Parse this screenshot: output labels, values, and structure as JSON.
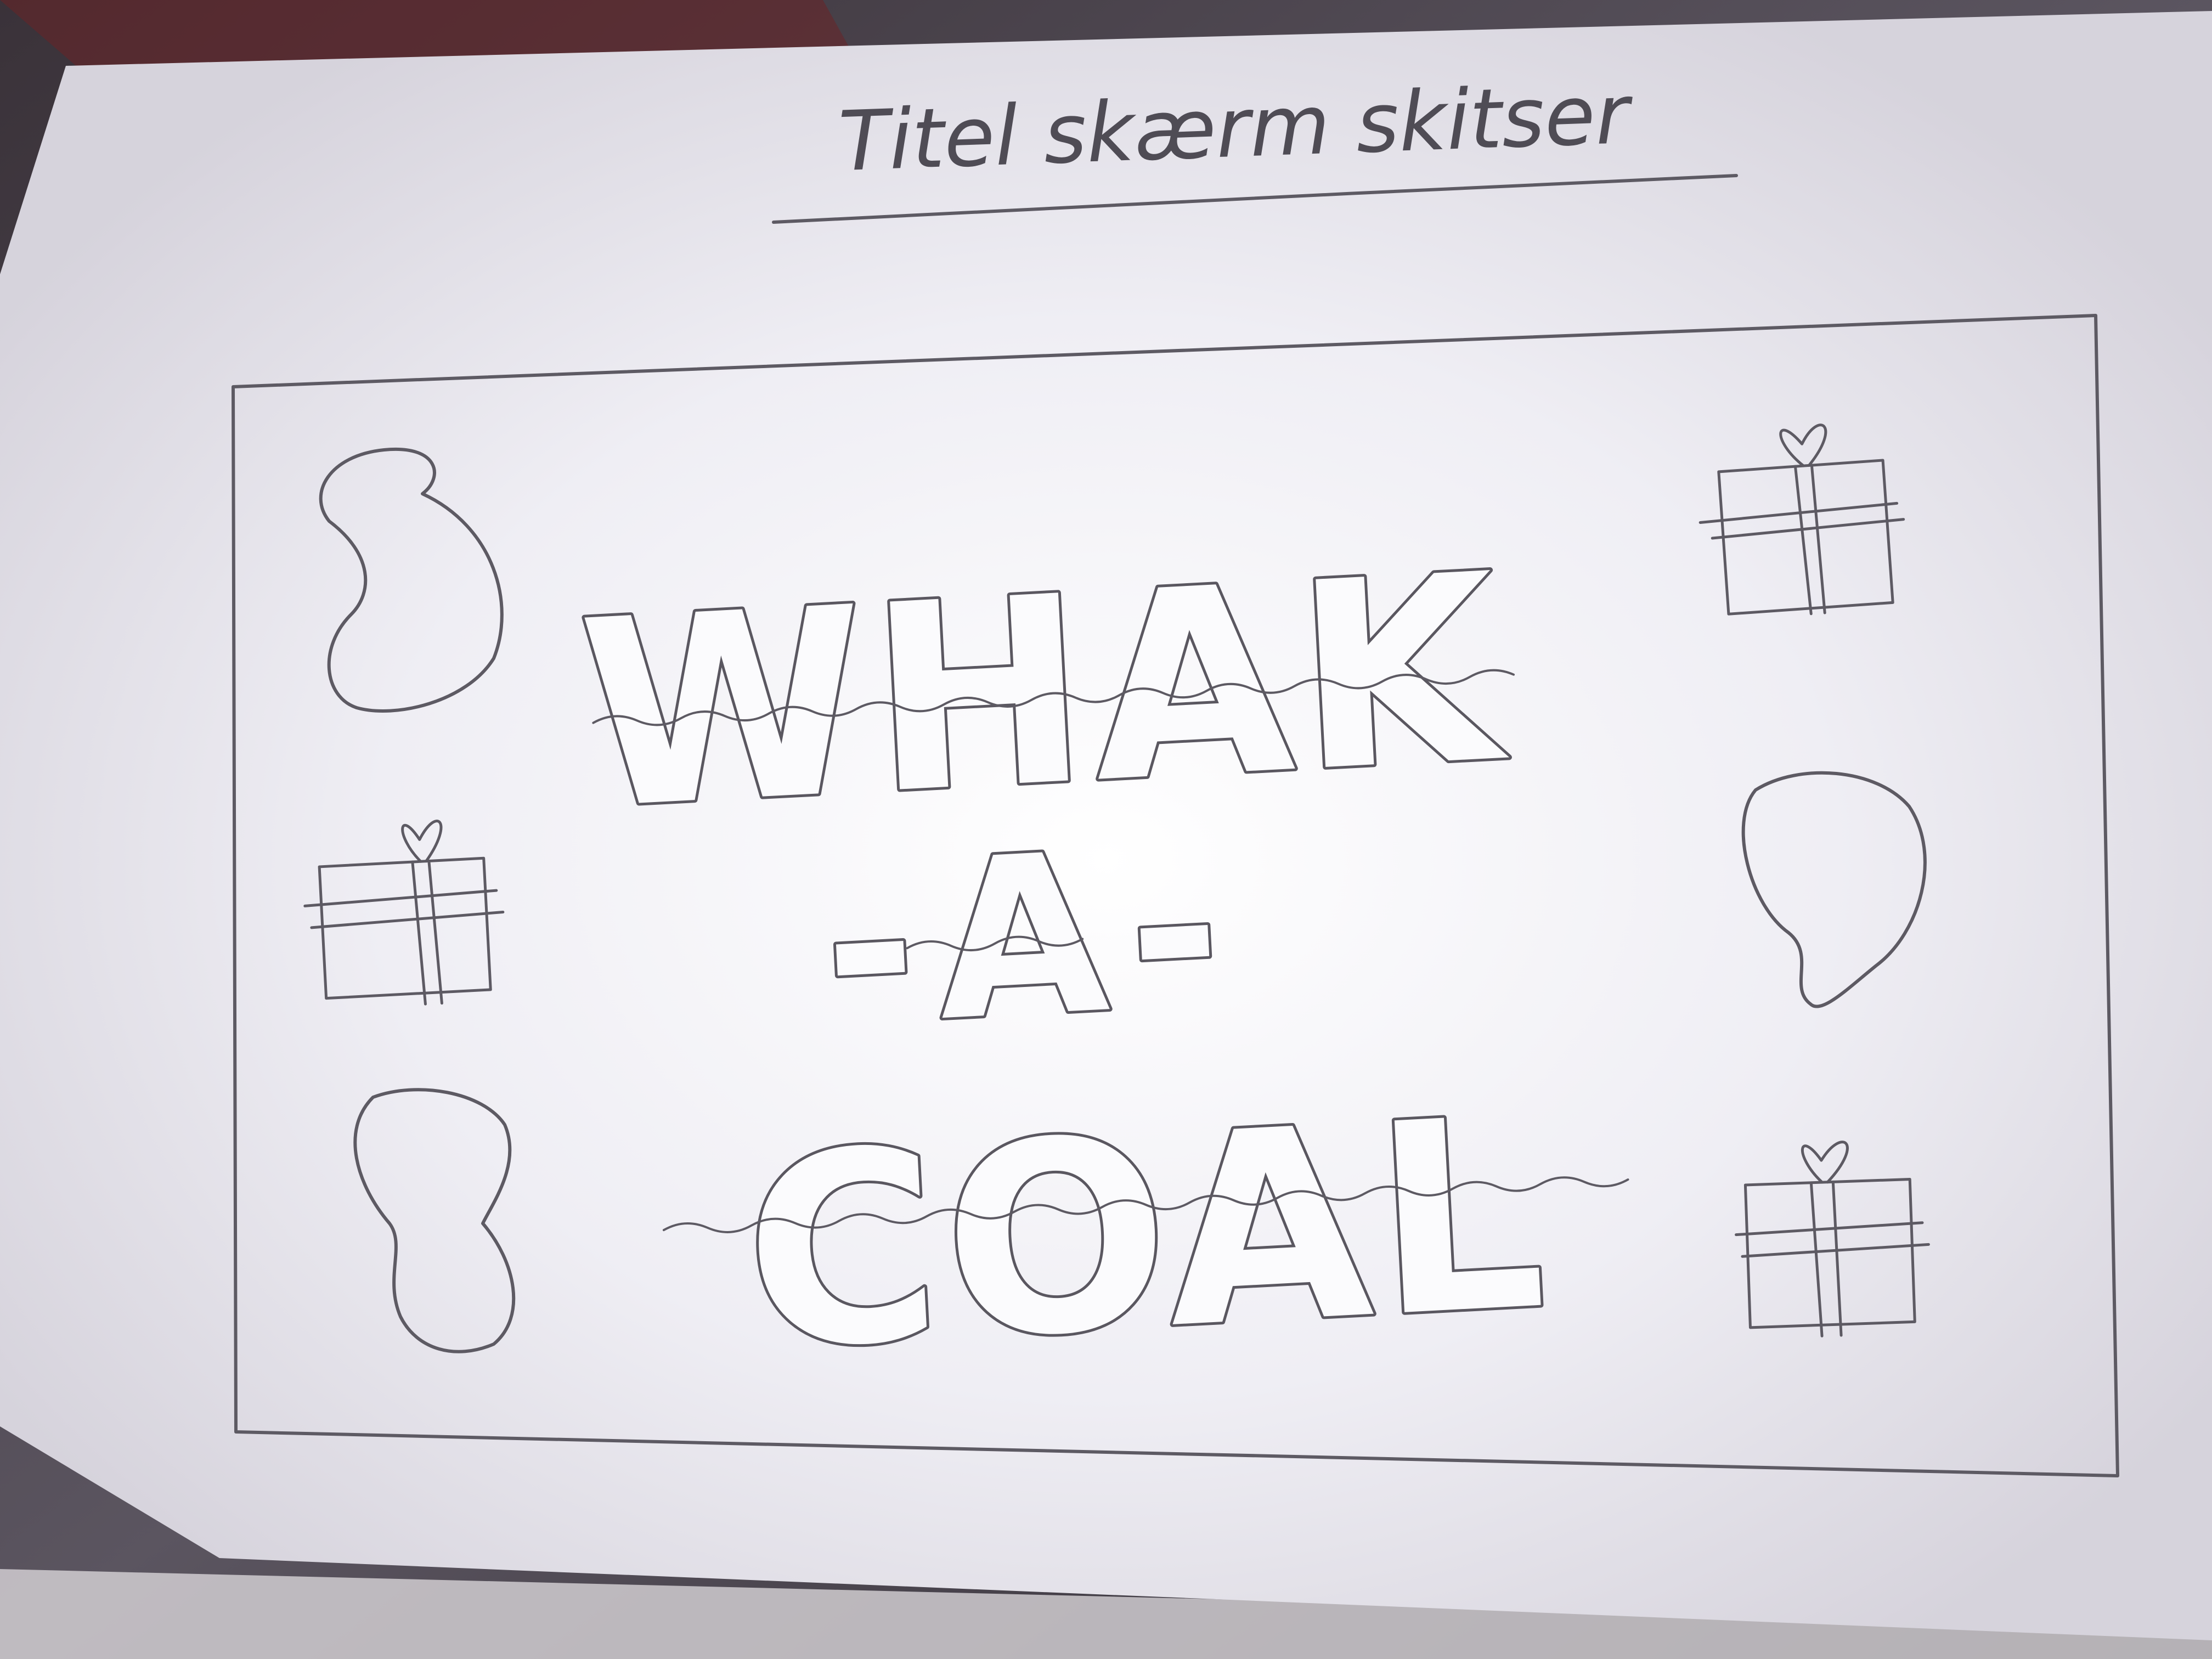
{
  "sheet": {
    "heading": "Titel skærm skitser"
  },
  "sketch": {
    "title_lines": [
      "WHAK",
      "-A-",
      "COAL"
    ],
    "decorations": {
      "coal_icon": "coal-lump",
      "gift_icon": "gift-box"
    }
  },
  "colors": {
    "paper": "#f2f1f6",
    "pencil": "#5d5a63",
    "background": "#2e2a30"
  }
}
